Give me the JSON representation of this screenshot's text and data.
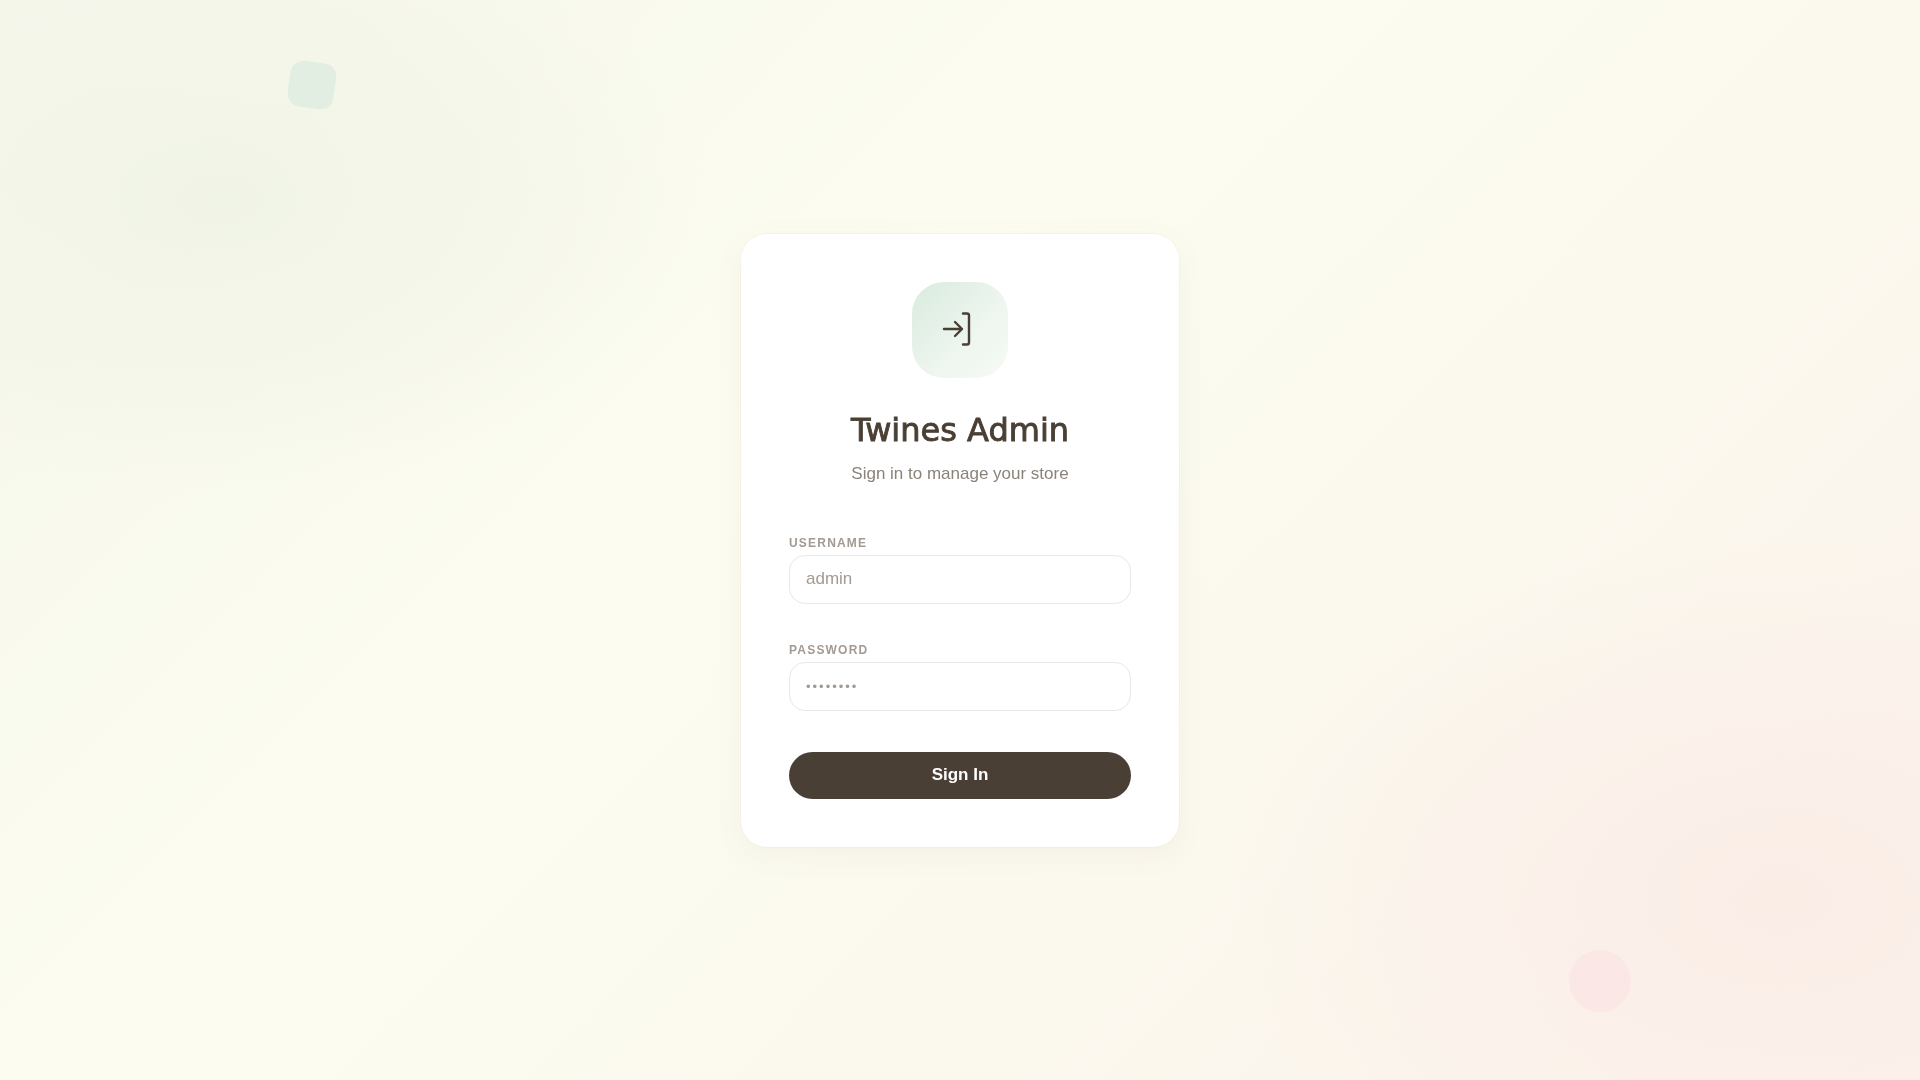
{
  "title": "Twines Admin",
  "subtitle": "Sign in to manage your store",
  "fields": [
    {
      "kind": "text",
      "label": "USERNAME",
      "placeholder": "admin"
    },
    {
      "kind": "password",
      "label": "PASSWORD",
      "placeholder": "••••••••"
    }
  ],
  "button": "Sign In"
}
